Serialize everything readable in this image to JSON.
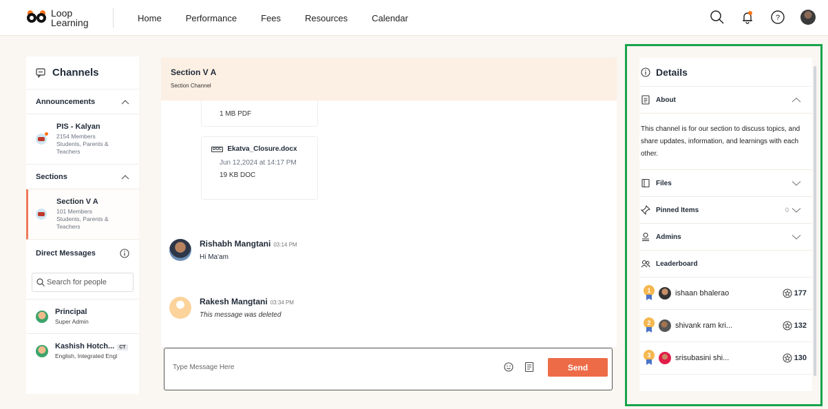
{
  "brand": {
    "line1": "Loop",
    "line2": "Learning"
  },
  "nav": [
    "Home",
    "Performance",
    "Fees",
    "Resources",
    "Calendar"
  ],
  "icons": {
    "search": "search-icon",
    "notifications": "bell-icon",
    "help": "help-icon",
    "profile": "user-avatar"
  },
  "channels": {
    "title": "Channels",
    "announcements": {
      "label": "Announcements",
      "items": [
        {
          "name": "PIS - Kalyan",
          "meta": "2154 Members Students, Parents & Teachers"
        }
      ]
    },
    "sections": {
      "label": "Sections",
      "items": [
        {
          "name": "Section V A",
          "meta": "101 Members Students, Parents & Teachers"
        }
      ]
    },
    "direct_messages": {
      "label": "Direct Messages",
      "search_placeholder": "Search for people",
      "items": [
        {
          "name": "Principal",
          "role": "Super Admin"
        },
        {
          "name": "Kashish Hotch...",
          "badge": "CT",
          "role": "English, Integrated Engl"
        }
      ]
    }
  },
  "chat": {
    "title": "Section V A",
    "subtitle": "Section Channel",
    "files": [
      {
        "size": "1 MB PDF"
      },
      {
        "name": "Ekatva_Closure.docx",
        "date": "Jun 12,2024 at 14:17 PM",
        "size": "19 KB DOC"
      }
    ],
    "messages": [
      {
        "author": "Rishabh Mangtani",
        "time": "03:14 PM",
        "text": "Hi Ma'am"
      },
      {
        "author": "Rakesh Mangtani",
        "time": "03:34 PM",
        "text": "This message was deleted"
      }
    ],
    "composer": {
      "placeholder": "Type Message Here",
      "send": "Send"
    }
  },
  "details": {
    "title": "Details",
    "about": {
      "label": "About",
      "text": "This channel is for our section to discuss topics, and share updates, information, and learnings with each other."
    },
    "files_label": "Files",
    "pinned": {
      "label": "Pinned Items",
      "count": "0"
    },
    "admins_label": "Admins",
    "leaderboard": {
      "label": "Leaderboard",
      "entries": [
        {
          "rank": "1",
          "name": "ishaan bhalerao",
          "score": "177"
        },
        {
          "rank": "2",
          "name": "shivank ram kri...",
          "score": "132"
        },
        {
          "rank": "3",
          "name": "srisubasini shi...",
          "score": "130"
        }
      ]
    }
  },
  "colors": {
    "accent": "#ee6b47",
    "highlight_box": "#16a34a",
    "header_bg": "#fcefe3"
  }
}
